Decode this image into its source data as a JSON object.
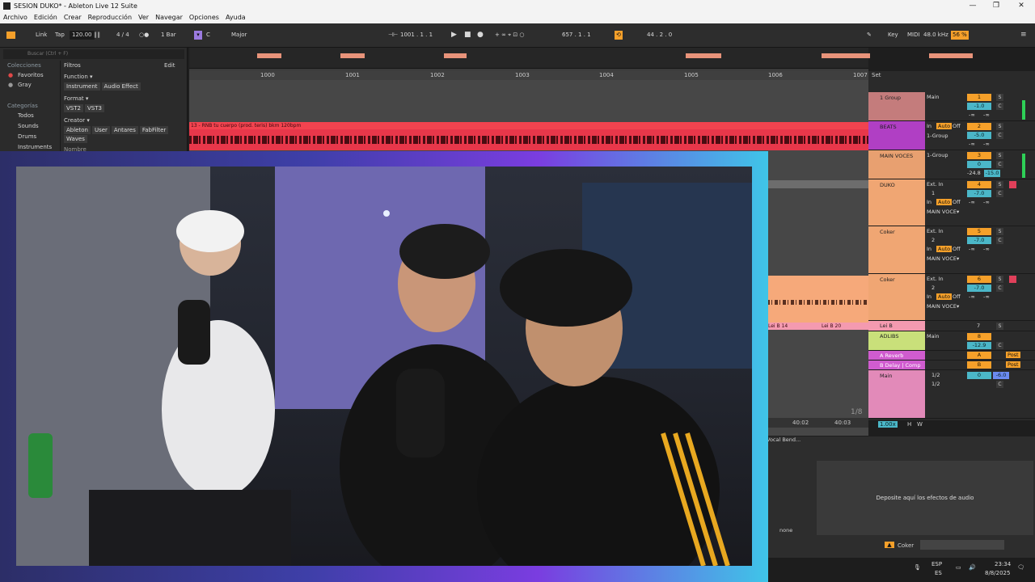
{
  "window": {
    "title": "SESION DUKO* - Ableton Live 12 Suite",
    "controls": [
      "—",
      "❐",
      "✕"
    ]
  },
  "menu": [
    "Archivo",
    "Edición",
    "Crear",
    "Reproducción",
    "Ver",
    "Navegar",
    "Opciones",
    "Ayuda"
  ],
  "control_bar": {
    "link": "Link",
    "tap": "Tap",
    "tempo": "120.00",
    "meter": "4 / 4",
    "quantize": "1 Bar",
    "key": "C",
    "scale": "Major",
    "position": "1001 .  1 .  1",
    "loop_start": "657 .  1 .  1",
    "loop_length": "44 .  2 .  0",
    "key_label": "Key",
    "midi_label": "MIDI",
    "sample_rate": "48.0 kHz",
    "cpu": "56 %",
    "colors": {
      "accent": "#f5a02a",
      "clip": "#f2434f"
    }
  },
  "browser": {
    "search_placeholder": "Buscar (Ctrl + F)",
    "colecciones_header": "Colecciones",
    "favoritos": "Favoritos",
    "gray": "Gray",
    "categorias_header": "Categorías",
    "categories": [
      "Todos",
      "Sounds",
      "Drums",
      "Instruments"
    ],
    "filtros": "Filtros",
    "edit": "Edit",
    "function_label": "Function ▾",
    "function_tags": [
      "Instrument",
      "Audio Effect"
    ],
    "format_label": "Format ▾",
    "format_tags": [
      "VST2",
      "VST3"
    ],
    "creator_label": "Creator ▾",
    "creator_tags": [
      "Ableton",
      "User",
      "Antares",
      "FabFilter"
    ],
    "creator_tags2": [
      "Waves"
    ],
    "nombre": "Nombre"
  },
  "arrangement": {
    "ruler": [
      "1000",
      "1001",
      "1002",
      "1003",
      "1004",
      "1005",
      "1006",
      "1007"
    ],
    "beats_clip_name": "13 - RNB tu cuerpo (prod. teris) bkm 120bpm",
    "lower_ruler": [
      "40:02",
      "40:03"
    ],
    "clip_lei14": "Lei B 14",
    "clip_lei20": "Lei B 20",
    "page_indicator": "1/8",
    "zoom": "1.00x",
    "h": "H",
    "w": "W"
  },
  "mixer": {
    "set_label": "Set",
    "tracks": [
      {
        "name": "1 Group",
        "io": "Main",
        "num": "1",
        "vol": "-1.0",
        "pan": "C",
        "s1": "-∞",
        "s2": "-∞",
        "color": "#c47c7c"
      },
      {
        "name": "BEATS",
        "io": "1-Group",
        "num": "2",
        "vol": "-5.0",
        "pan": "C",
        "s1": "-∞",
        "s2": "-∞",
        "color": "#b03fc4",
        "inout": "In",
        "auto": "Auto",
        "off": "Off"
      },
      {
        "name": "MAIN VOCES",
        "io": "1-Group",
        "num": "3",
        "vol": "0",
        "pan": "C",
        "s1": "-24.8",
        "s2": "-15.0",
        "color": "#e8a070"
      },
      {
        "name": "DUKO",
        "io": "Ext. In",
        "ch": "1",
        "num": "4",
        "vol": "-7.0",
        "pan": "C",
        "s1": "-∞",
        "s2": "-∞",
        "out": "MAIN VOCE▾",
        "color": "#f0a673",
        "inout": "In",
        "auto": "Auto",
        "off": "Off"
      },
      {
        "name": "Coker",
        "io": "Ext. In",
        "ch": "2",
        "num": "5",
        "vol": "-7.0",
        "pan": "C",
        "s1": "-∞",
        "s2": "-∞",
        "out": "MAIN VOCE▾",
        "color": "#f0a673",
        "inout": "In",
        "auto": "Auto",
        "off": "Off"
      },
      {
        "name": "Coker",
        "io": "Ext. In",
        "ch": "2",
        "num": "6",
        "vol": "-7.0",
        "pan": "C",
        "s1": "-∞",
        "s2": "-∞",
        "out": "MAIN VOCE▾",
        "color": "#f0a673",
        "inout": "In",
        "auto": "Auto",
        "off": "Off"
      },
      {
        "name": "Lei B",
        "num": "7",
        "color": "#f0a673"
      },
      {
        "name": "ADLIBS",
        "io": "Main",
        "num": "8",
        "vol": "-12.9",
        "pan": "C",
        "color": "#c9e07a"
      },
      {
        "name": "A Reverb",
        "num": "A",
        "post": "Post",
        "color": "#d05ccf"
      },
      {
        "name": "B Delay | Comp",
        "num": "B",
        "post": "Post",
        "color": "#d05ccf"
      },
      {
        "name": "Main",
        "io": "1/2",
        "io2": "1/2",
        "num": "0",
        "vol": "-6.0",
        "pan": "C",
        "color": "#e28ab9"
      }
    ]
  },
  "detail": {
    "device": "Vocal Bend...",
    "none": "none",
    "drop_text": "Deposite aquí los efectos de audio",
    "track_label": "Coker"
  },
  "taskbar": {
    "lang": "ESP",
    "lang2": "ES",
    "time": "23:34",
    "date": "8/8/2025"
  }
}
